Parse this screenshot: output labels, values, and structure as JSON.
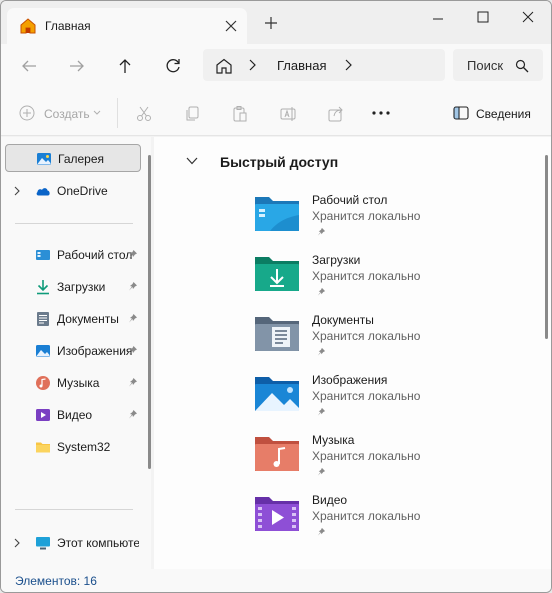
{
  "tab": {
    "title": "Главная"
  },
  "address": {
    "crumb": "Главная"
  },
  "search": {
    "placeholder": "Поиск"
  },
  "commandbar": {
    "create_label": "Создать",
    "details_label": "Сведения"
  },
  "nav": {
    "gallery": "Галерея",
    "onedrive": "OneDrive",
    "desktop": "Рабочий стол",
    "downloads": "Загрузки",
    "documents": "Документы",
    "pictures": "Изображения",
    "music": "Музыка",
    "videos": "Видео",
    "system32": "System32",
    "thispc": "Этот компьютер"
  },
  "quick_access": {
    "title": "Быстрый доступ",
    "items": [
      {
        "name": "Рабочий стол",
        "sub": "Хранится локально",
        "icon": "desktop-folder-icon"
      },
      {
        "name": "Загрузки",
        "sub": "Хранится локально",
        "icon": "downloads-folder-icon"
      },
      {
        "name": "Документы",
        "sub": "Хранится локально",
        "icon": "documents-folder-icon"
      },
      {
        "name": "Изображения",
        "sub": "Хранится локально",
        "icon": "pictures-folder-icon"
      },
      {
        "name": "Музыка",
        "sub": "Хранится локально",
        "icon": "music-folder-icon"
      },
      {
        "name": "Видео",
        "sub": "Хранится локально",
        "icon": "videos-folder-icon"
      }
    ]
  },
  "status": {
    "count": "Элементов: 16"
  },
  "colors": {
    "accent": "#0067c0",
    "status_text": "#1a4f8c",
    "selection": "#e6e6e6"
  }
}
